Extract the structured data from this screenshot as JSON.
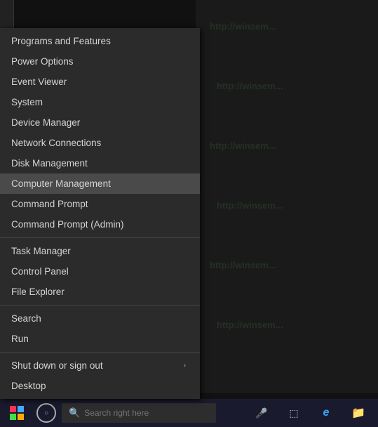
{
  "background": {
    "color": "#111111"
  },
  "context_menu": {
    "items": [
      {
        "id": "programs-features",
        "label": "Programs and Features",
        "has_arrow": false,
        "active": false,
        "separator_after": false
      },
      {
        "id": "power-options",
        "label": "Power Options",
        "has_arrow": false,
        "active": false,
        "separator_after": false
      },
      {
        "id": "event-viewer",
        "label": "Event Viewer",
        "has_arrow": false,
        "active": false,
        "separator_after": false
      },
      {
        "id": "system",
        "label": "System",
        "has_arrow": false,
        "active": false,
        "separator_after": false
      },
      {
        "id": "device-manager",
        "label": "Device Manager",
        "has_arrow": false,
        "active": false,
        "separator_after": false
      },
      {
        "id": "network-connections",
        "label": "Network Connections",
        "has_arrow": false,
        "active": false,
        "separator_after": false
      },
      {
        "id": "disk-management",
        "label": "Disk Management",
        "has_arrow": false,
        "active": false,
        "separator_after": false
      },
      {
        "id": "computer-management",
        "label": "Computer Management",
        "has_arrow": false,
        "active": true,
        "separator_after": false
      },
      {
        "id": "command-prompt",
        "label": "Command Prompt",
        "has_arrow": false,
        "active": false,
        "separator_after": false
      },
      {
        "id": "command-prompt-admin",
        "label": "Command Prompt (Admin)",
        "has_arrow": false,
        "active": false,
        "separator_after": true
      },
      {
        "id": "task-manager",
        "label": "Task Manager",
        "has_arrow": false,
        "active": false,
        "separator_after": false
      },
      {
        "id": "control-panel",
        "label": "Control Panel",
        "has_arrow": false,
        "active": false,
        "separator_after": false
      },
      {
        "id": "file-explorer",
        "label": "File Explorer",
        "has_arrow": false,
        "active": false,
        "separator_after": true
      },
      {
        "id": "search",
        "label": "Search",
        "has_arrow": false,
        "active": false,
        "separator_after": false
      },
      {
        "id": "run",
        "label": "Run",
        "has_arrow": false,
        "active": false,
        "separator_after": true
      },
      {
        "id": "shut-down",
        "label": "Shut down or sign out",
        "has_arrow": true,
        "active": false,
        "separator_after": false
      },
      {
        "id": "desktop",
        "label": "Desktop",
        "has_arrow": false,
        "active": false,
        "separator_after": false
      }
    ]
  },
  "taskbar": {
    "search_placeholder": "Search right here",
    "icons": {
      "mic": "🎤",
      "task_view": "⬛",
      "edge": "e",
      "folder": "📁"
    }
  }
}
